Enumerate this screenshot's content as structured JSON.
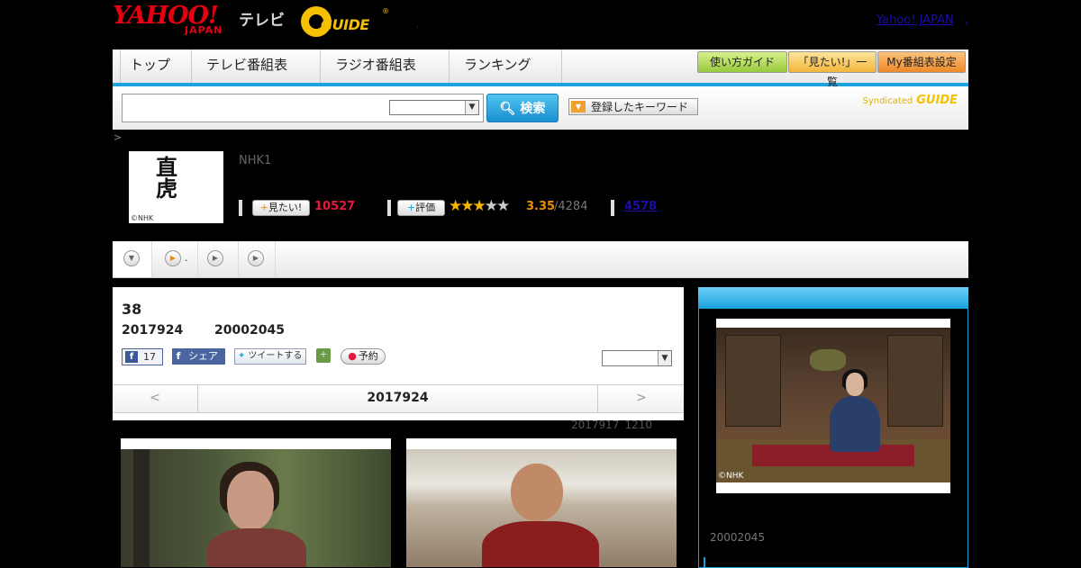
{
  "header": {
    "yahoo_logo": "YAHOO!",
    "yahoo_japan": "JAPAN",
    "tv_label": "テレビ",
    "gguide_logo": "GUIDE",
    "gguide_reg": "®",
    "yahoo_link": "Yahoo! JAPAN",
    "small_link_a": ",",
    "small_link_b": ","
  },
  "nav": {
    "tabs": [
      "トップ",
      "テレビ番組表",
      "ラジオ番組表",
      "ランキング"
    ],
    "buttons": [
      "使い方ガイド",
      "「見たい!」一覧",
      "My番組表設定"
    ]
  },
  "search": {
    "input_value": "",
    "select_value": "",
    "button_label": "検索",
    "keyword_button": "登録したキーワード",
    "syndicated": "Syndicated",
    "syndicated_logo": "GUIDE"
  },
  "program": {
    "breadcrumb": ">",
    "thumb_title": "直虎",
    "thumb_copyright": "©NHK",
    "channel": "NHK1",
    "mitai_label": "見たい!",
    "mitai_count": "10527",
    "hyoka_label": "評価",
    "rating": 3.35,
    "rating_text": "3.35",
    "rating_count": "/4284",
    "link_count": "4578"
  },
  "tabs": {
    "tab2_label": "."
  },
  "episode": {
    "title": "38",
    "date": "2017924",
    "time": "20002045",
    "fb_count": "17",
    "share_label": "シェア",
    "tweet_label": "ツイートする",
    "reserve_label": "予約",
    "select_value": "",
    "pager_prev": "<",
    "pager_center": "2017924",
    "pager_next": ">",
    "updated_date": "2017917",
    "updated_time": "1210"
  },
  "sidebar": {
    "image_copyright": "©NHK",
    "time": "20002045"
  },
  "colors": {
    "accent": "#1ea3de",
    "mitai": "#e8153c",
    "rating": "#f08c00",
    "gguide": "#f5c000"
  }
}
